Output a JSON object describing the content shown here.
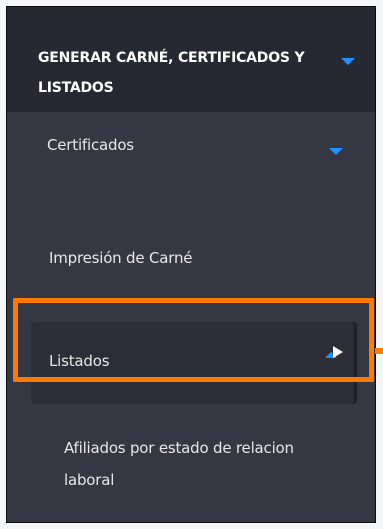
{
  "menu": {
    "header_title": "GENERAR CARNÉ, CERTIFICADOS Y LISTADOS",
    "header_caret_icon": "caret-down-icon",
    "items": [
      {
        "label": "Certificados",
        "icon": "caret-down-icon"
      },
      {
        "label": "Impresión de Carné"
      },
      {
        "label": "Listados",
        "icon": "caret-up-icon",
        "pointer": "arrow-right-icon"
      }
    ],
    "subitems": [
      {
        "label": "Afiliados por estado de relacion laboral"
      }
    ]
  },
  "colors": {
    "panel_bg": "#272932",
    "submenu_bg": "#353742",
    "accent_blue": "#1e90ff",
    "highlight_orange": "#ff7a00",
    "text": "#e8e8ea"
  }
}
